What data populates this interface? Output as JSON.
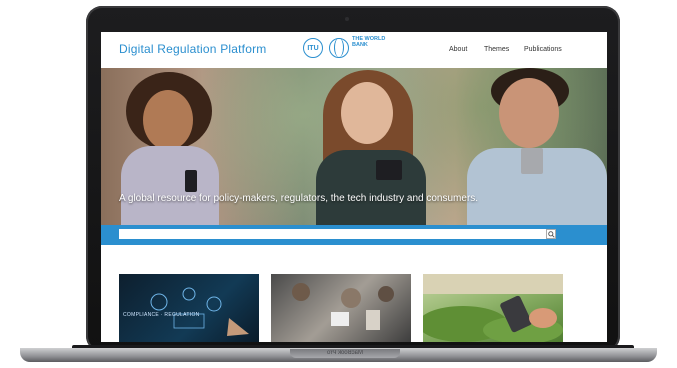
{
  "site": {
    "title": "Digital Regulation Platform",
    "itu_logo_text": "ITU",
    "wb_logo_text": "THE WORLD BANK"
  },
  "nav": {
    "items": [
      {
        "label": "About"
      },
      {
        "label": "Themes"
      },
      {
        "label": "Publications"
      }
    ]
  },
  "hero": {
    "caption": "A global resource for policy-makers, regulators, the tech industry and consumers."
  },
  "search": {
    "placeholder": "",
    "value": ""
  },
  "cards": [
    {
      "label": "COMPLIANCE · REGULATION"
    },
    {
      "label": ""
    },
    {
      "label": ""
    }
  ],
  "device": {
    "label": "MacBook Pro"
  },
  "colors": {
    "brand_blue": "#2b8fcf"
  }
}
